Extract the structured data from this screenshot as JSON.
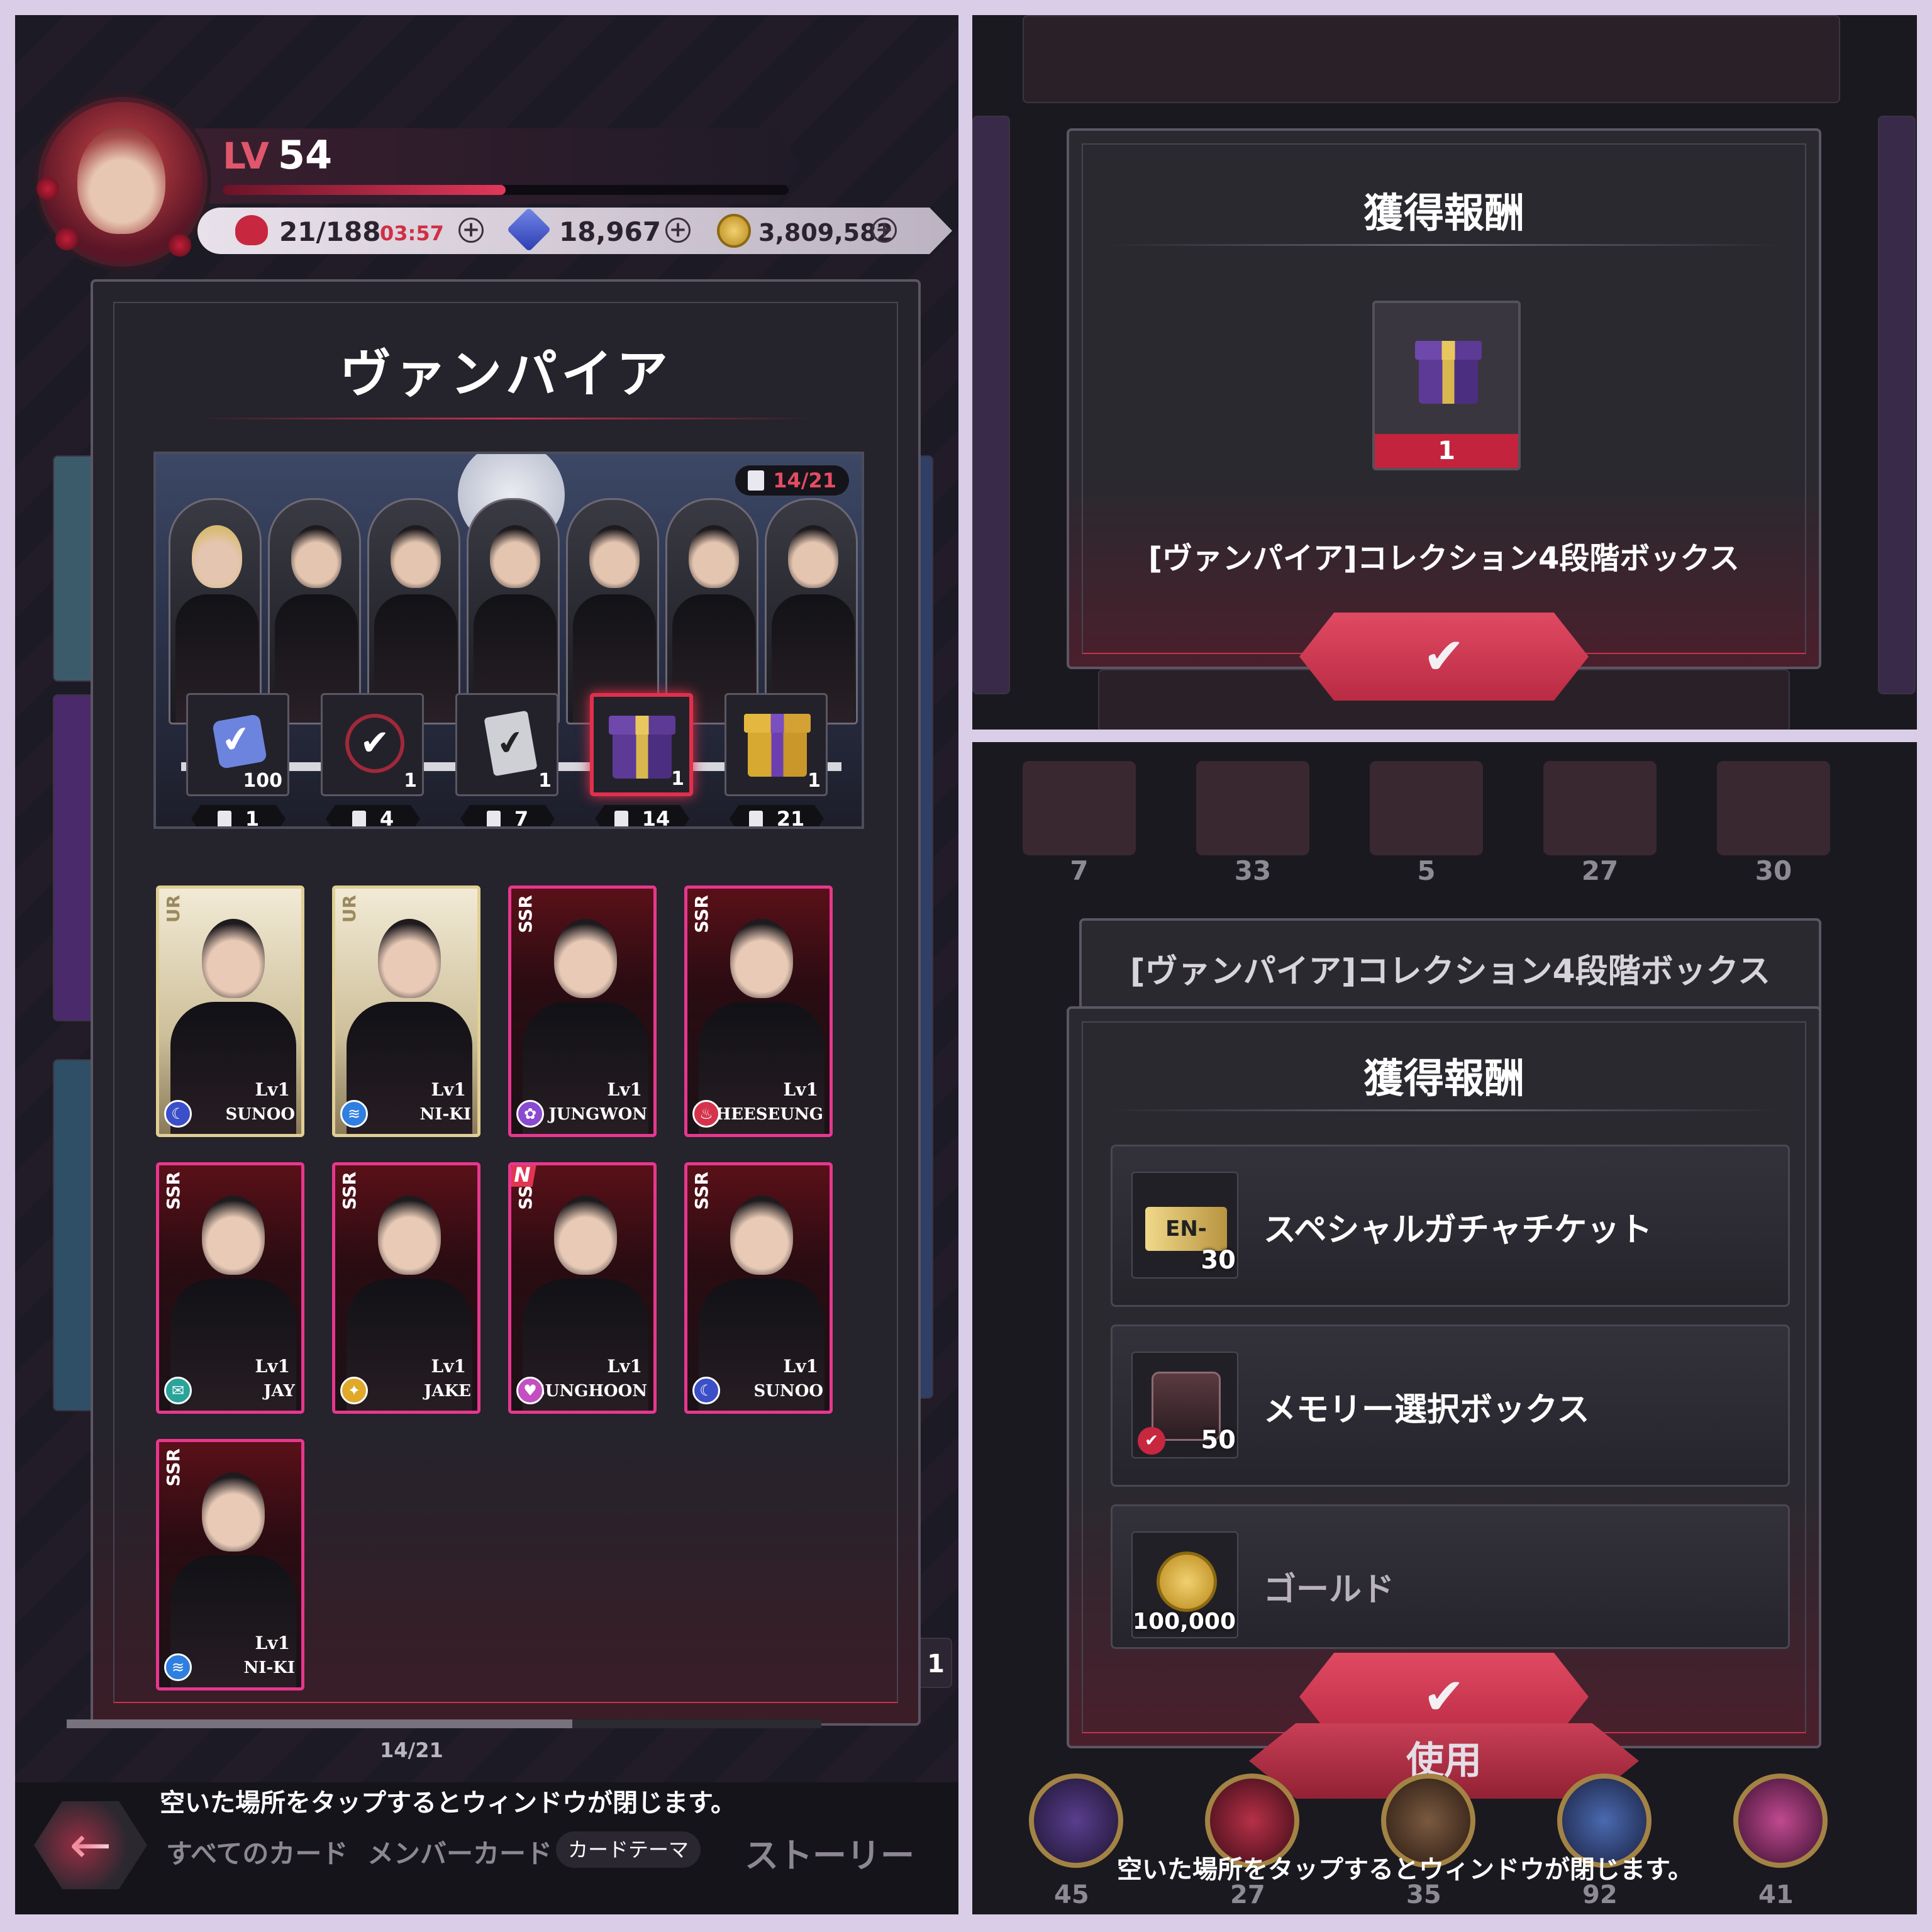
{
  "left": {
    "level_prefix": "LV",
    "level": "54",
    "stamina": "21/188",
    "timer": "03:57",
    "gems": "18,967",
    "gold": "3,809,582",
    "modal_title": "ヴァンパイア",
    "collection_count": "14/21",
    "milestones": [
      {
        "qty": "100",
        "req": "1",
        "icon": "check-ticket-icon"
      },
      {
        "qty": "1",
        "req": "4",
        "icon": "badge-check-icon"
      },
      {
        "qty": "1",
        "req": "7",
        "icon": "card-check-icon"
      },
      {
        "qty": "1",
        "req": "14",
        "icon": "purple-gift-icon"
      },
      {
        "qty": "1",
        "req": "21",
        "icon": "gold-gift-icon"
      }
    ],
    "cards": [
      {
        "rarity": "UR",
        "lv": "Lv1",
        "name": "SUNOO",
        "elem": "☾",
        "elem_color": "#3b4fc8"
      },
      {
        "rarity": "UR",
        "lv": "Lv1",
        "name": "NI-KI",
        "elem": "≋",
        "elem_color": "#2e7fe0"
      },
      {
        "rarity": "SSR",
        "lv": "Lv1",
        "name": "JUNGWON",
        "elem": "✿",
        "elem_color": "#8a4ad0"
      },
      {
        "rarity": "SSR",
        "lv": "Lv1",
        "name": "HEESEUNG",
        "elem": "♨",
        "elem_color": "#d5334c"
      },
      {
        "rarity": "SSR",
        "lv": "Lv1",
        "name": "JAY",
        "elem": "✉",
        "elem_color": "#2aa39a"
      },
      {
        "rarity": "SSR",
        "lv": "Lv1",
        "name": "JAKE",
        "elem": "✦",
        "elem_color": "#e0a92a"
      },
      {
        "rarity": "SSR",
        "lv": "Lv1",
        "name": "SUNGHOON",
        "elem": "♥",
        "elem_color": "#c44fc0",
        "new": "N"
      },
      {
        "rarity": "SSR",
        "lv": "Lv1",
        "name": "SUNOO",
        "elem": "☾",
        "elem_color": "#3b4fc8"
      },
      {
        "rarity": "SSR",
        "lv": "Lv1",
        "name": "NI-KI",
        "elem": "≋",
        "elem_color": "#2e7fe0"
      }
    ],
    "progress_label": "14/21",
    "close_hint": "空いた場所をタップするとウィンドウが閉じます。",
    "tabs": [
      "すべてのカード",
      "メンバーカード",
      "カードテーマ",
      "ストーリー"
    ],
    "bg_badge_qty": "1",
    "back_icon": "←"
  },
  "top_right": {
    "title": "獲得報酬",
    "item_qty": "1",
    "item_name": "[ヴァンパイア]コレクション4段階ボックス",
    "ok_icon": "✔"
  },
  "bottom_right": {
    "back_title": "[ヴァンパイア]コレクション4段階ボックス",
    "title": "獲得報酬",
    "rewards": [
      {
        "label": "スペシャルガチャチケット",
        "qty": "30",
        "icon_text": "EN-",
        "icon": "gacha-ticket-icon"
      },
      {
        "label": "メモリー選択ボックス",
        "qty": "50",
        "icon": "memory-box-icon"
      },
      {
        "label": "ゴールド",
        "qty": "100,000",
        "icon": "gold-coin-icon"
      }
    ],
    "tapes": [
      "7",
      "33",
      "5",
      "27",
      "30"
    ],
    "emblems": [
      "45",
      "27",
      "35",
      "92",
      "41"
    ],
    "ok_icon": "✔",
    "use_label": "使用",
    "close_hint": "空いた場所をタップするとウィンドウが閉じます。"
  }
}
